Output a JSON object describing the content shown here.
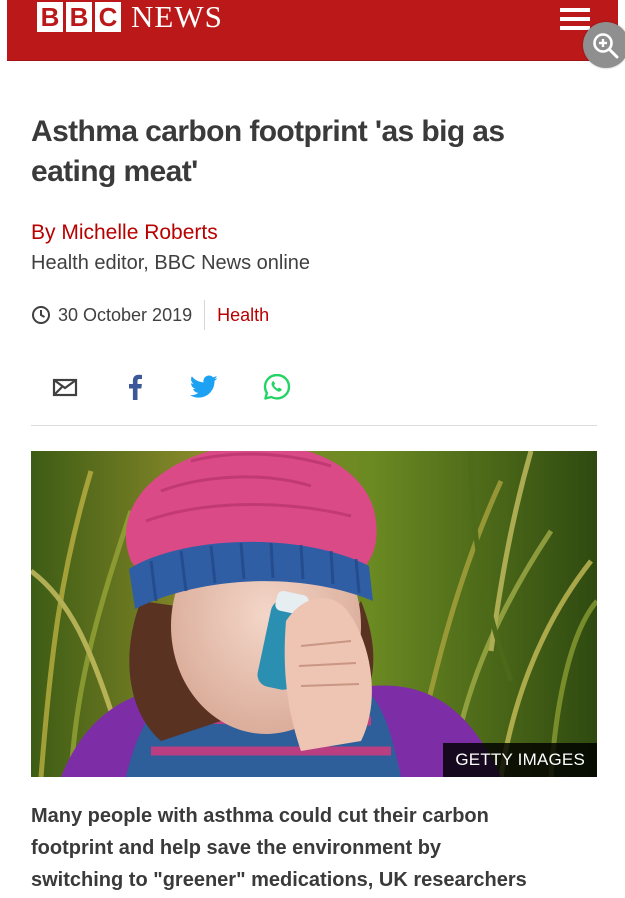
{
  "header": {
    "brand_blocks": [
      "B",
      "B",
      "C"
    ],
    "brand_word": "NEWS",
    "menu_icon": "hamburger-menu-icon",
    "zoom_icon": "zoom-in-icon",
    "background_color": "#bb1919"
  },
  "article": {
    "headline": "Asthma carbon footprint 'as big as eating meat'",
    "byline_name": "By Michelle Roberts",
    "byline_role": "Health editor, BBC News online",
    "date": "30 October 2019",
    "category": "Health",
    "share_icons": [
      "email-icon",
      "facebook-icon",
      "twitter-icon",
      "whatsapp-icon"
    ],
    "image_credit": "GETTY IMAGES",
    "intro": "Many people with asthma could cut their carbon\nfootprint and help save the environment by\nswitching to \"greener\" medications, UK researchers"
  },
  "colors": {
    "brand_red": "#bb1919",
    "link_red": "#b80000",
    "facebook_blue": "#3b5998",
    "twitter_blue": "#1da1f2",
    "whatsapp_green": "#25d366"
  }
}
